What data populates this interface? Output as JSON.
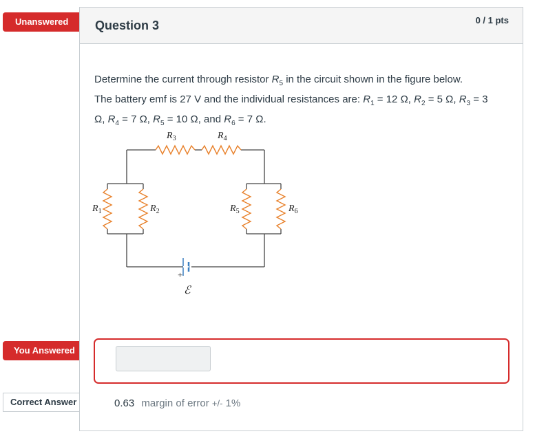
{
  "flags": {
    "unanswered": "Unanswered",
    "you_answered": "You Answered",
    "correct_answer": "Correct Answer"
  },
  "question": {
    "title": "Question 3",
    "points": "0 / 1 pts",
    "text_line1_pre": "Determine the current through resistor ",
    "text_line1_post": " in the circuit shown in the figure below.",
    "text_line2_pre": "The battery emf is 27 V and the individual resistances are: ",
    "r1_val": " = 12 Ω, ",
    "r2_val": " = 5 Ω, ",
    "r3_val": " = 3",
    "line3_omega": "Ω, ",
    "r4_val": " = 7 Ω, ",
    "r5_val": " = 10 Ω, and ",
    "r6_val": " = 7 Ω."
  },
  "circuit": {
    "labels": {
      "r1": "R",
      "r1_sub": "1",
      "r2": "R",
      "r2_sub": "2",
      "r3": "R",
      "r3_sub": "3",
      "r4": "R",
      "r4_sub": "4",
      "r5": "R",
      "r5_sub": "5",
      "r6": "R",
      "r6_sub": "6",
      "plus": "+",
      "emf": "ℰ"
    }
  },
  "answer": {
    "student_value": "",
    "correct_value": "0.63",
    "margin_prefix": "margin of error ",
    "margin_pm": "+/-",
    "margin_value": " 1%"
  },
  "colors": {
    "flag_red": "#d52b2b",
    "border": "#c7cdd1",
    "resistor_orange": "#e8812b",
    "battery_blue": "#3a7fc1",
    "text": "#2d3b45"
  }
}
